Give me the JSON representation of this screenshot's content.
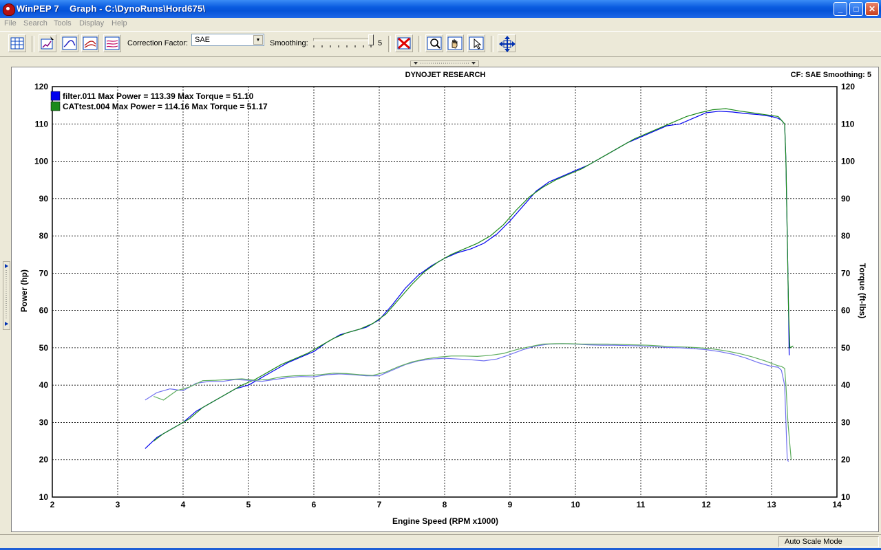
{
  "window": {
    "title": "WinPEP 7    Graph - C:\\DynoRuns\\Hord675\\",
    "minimize": "_",
    "maximize": "□",
    "close": "✕"
  },
  "menu": {
    "file": "File",
    "search": "Search",
    "tools": "Tools",
    "display": "Display",
    "help": "Help"
  },
  "toolbar": {
    "correction_label": "Correction Factor:",
    "correction_value": "SAE",
    "smoothing_label": "Smoothing:",
    "smoothing_value": "5",
    "smoothing_level": 5
  },
  "chart_header": {
    "title": "DYNOJET RESEARCH",
    "info": "CF: SAE  Smoothing: 5"
  },
  "status": {
    "mode": "Auto Scale Mode"
  },
  "colors": {
    "run1": "#0000ee",
    "run2": "#1a8a1a",
    "grid": "#000000"
  },
  "chart_data": {
    "type": "line",
    "xlabel": "Engine Speed (RPM x1000)",
    "ylabel": "Power (hp)",
    "ylabel_right": "Torque (ft-lbs)",
    "xlim": [
      2,
      14
    ],
    "ylim": [
      10,
      120
    ],
    "ylim_right": [
      10,
      120
    ],
    "x_ticks": [
      "2",
      "3",
      "4",
      "5",
      "6",
      "7",
      "8",
      "9",
      "10",
      "11",
      "12",
      "13",
      "14"
    ],
    "y_ticks": [
      "10",
      "20",
      "30",
      "40",
      "50",
      "60",
      "70",
      "80",
      "90",
      "100",
      "110",
      "120"
    ],
    "grid": true,
    "legend_position": "top-left",
    "legend": [
      {
        "label": "filter.011 Max Power = 113.39 Max Torque = 51.10",
        "color": "#0000ee"
      },
      {
        "label": "CATtest.004 Max Power = 114.16 Max Torque = 51.17",
        "color": "#1a8a1a"
      }
    ],
    "series": [
      {
        "name": "filter.011",
        "kind": "power",
        "axis": "left",
        "color": "#0000ee",
        "x": [
          3.42,
          3.6,
          3.8,
          4.0,
          4.2,
          4.4,
          4.6,
          4.8,
          5.0,
          5.2,
          5.4,
          5.6,
          5.8,
          6.0,
          6.2,
          6.4,
          6.6,
          6.8,
          7.0,
          7.2,
          7.4,
          7.6,
          7.8,
          8.0,
          8.2,
          8.4,
          8.6,
          8.8,
          9.0,
          9.2,
          9.4,
          9.6,
          9.8,
          10.0,
          10.2,
          10.4,
          10.6,
          10.8,
          11.0,
          11.2,
          11.4,
          11.6,
          11.8,
          12.0,
          12.2,
          12.4,
          12.6,
          12.8,
          13.0,
          13.1,
          13.15,
          13.2,
          13.22,
          13.24,
          13.26,
          13.27
        ],
        "y": [
          23,
          26,
          28,
          30,
          33,
          35,
          37,
          39,
          40,
          42,
          44,
          46,
          47.5,
          49,
          51.5,
          53.5,
          54.5,
          55.5,
          57.5,
          61.5,
          66,
          69.5,
          72,
          74,
          75.5,
          76.5,
          78,
          80.5,
          84,
          88,
          92,
          94.5,
          96,
          97.5,
          99,
          101,
          103,
          105,
          106.5,
          108,
          109.5,
          110,
          111.5,
          113,
          113.4,
          113.2,
          112.8,
          112.5,
          112,
          111.5,
          111,
          110,
          100,
          80,
          60,
          48
        ]
      },
      {
        "name": "CATtest.004",
        "kind": "power",
        "axis": "left",
        "color": "#1a8a1a",
        "x": [
          3.55,
          3.7,
          3.9,
          4.1,
          4.3,
          4.5,
          4.7,
          4.9,
          5.1,
          5.3,
          5.5,
          5.7,
          5.9,
          6.1,
          6.3,
          6.5,
          6.7,
          6.9,
          7.1,
          7.3,
          7.5,
          7.7,
          7.9,
          8.1,
          8.3,
          8.5,
          8.7,
          8.9,
          9.1,
          9.3,
          9.5,
          9.7,
          9.9,
          10.1,
          10.3,
          10.5,
          10.7,
          10.9,
          11.1,
          11.3,
          11.5,
          11.7,
          11.9,
          12.1,
          12.3,
          12.5,
          12.7,
          12.9,
          13.1,
          13.15,
          13.2,
          13.22,
          13.24,
          13.26,
          13.28,
          13.33
        ],
        "y": [
          25,
          27,
          29,
          31,
          34,
          36,
          38,
          40,
          41.5,
          43.5,
          45.5,
          47,
          48.5,
          50.5,
          52.5,
          54,
          55,
          56.5,
          59,
          63,
          67,
          70.5,
          73,
          75,
          76.5,
          78,
          80,
          83,
          87,
          90.5,
          93,
          95,
          96.5,
          98,
          100,
          102,
          104,
          106,
          107.5,
          109,
          110.5,
          112,
          113,
          113.8,
          114.1,
          113.5,
          113,
          112.5,
          112,
          111,
          110,
          100,
          80,
          60,
          50,
          50.5
        ]
      },
      {
        "name": "filter.011",
        "kind": "torque",
        "axis": "right",
        "color": "#7070f0",
        "x": [
          3.42,
          3.6,
          3.8,
          4.0,
          4.2,
          4.4,
          4.6,
          4.8,
          5.0,
          5.2,
          5.4,
          5.6,
          5.8,
          6.0,
          6.2,
          6.4,
          6.6,
          6.8,
          7.0,
          7.2,
          7.4,
          7.6,
          7.8,
          8.0,
          8.2,
          8.4,
          8.6,
          8.8,
          9.0,
          9.2,
          9.4,
          9.6,
          9.8,
          10.0,
          10.2,
          10.4,
          10.6,
          10.8,
          11.0,
          11.2,
          11.4,
          11.6,
          11.8,
          12.0,
          12.2,
          12.4,
          12.6,
          12.8,
          13.0,
          13.1,
          13.15,
          13.2,
          13.22,
          13.24,
          13.26
        ],
        "y": [
          36,
          38,
          39,
          38.5,
          40.5,
          41,
          41,
          41.5,
          41.3,
          41,
          41.5,
          42,
          42.3,
          42.2,
          42.8,
          43,
          42.8,
          42.5,
          42.5,
          44,
          45.5,
          46.5,
          47,
          47.2,
          47,
          46.8,
          46.5,
          47,
          48.2,
          49.5,
          50.5,
          51,
          51.1,
          51,
          50.8,
          50.7,
          50.7,
          50.6,
          50.5,
          50.3,
          50.1,
          50,
          49.8,
          49.5,
          49,
          48.3,
          47.3,
          46,
          45,
          44.8,
          44,
          40,
          30,
          20,
          19.5
        ]
      },
      {
        "name": "CATtest.004",
        "kind": "torque",
        "axis": "right",
        "color": "#5fae5f",
        "x": [
          3.55,
          3.7,
          3.9,
          4.1,
          4.3,
          4.5,
          4.7,
          4.9,
          5.1,
          5.3,
          5.5,
          5.7,
          5.9,
          6.1,
          6.3,
          6.5,
          6.7,
          6.9,
          7.1,
          7.3,
          7.5,
          7.7,
          7.9,
          8.1,
          8.3,
          8.5,
          8.7,
          8.9,
          9.1,
          9.3,
          9.5,
          9.7,
          9.9,
          10.1,
          10.3,
          10.5,
          10.7,
          10.9,
          11.1,
          11.3,
          11.5,
          11.7,
          11.9,
          12.1,
          12.3,
          12.5,
          12.7,
          12.9,
          13.1,
          13.15,
          13.2,
          13.22,
          13.25,
          13.3
        ],
        "y": [
          37,
          36,
          38.5,
          39.5,
          41.2,
          41.3,
          41.5,
          41.7,
          41.3,
          41.5,
          42.2,
          42.5,
          42.6,
          42.8,
          43.2,
          43.1,
          42.8,
          42.6,
          43.5,
          45,
          46.2,
          47,
          47.5,
          47.8,
          47.8,
          47.7,
          48,
          48.5,
          49.5,
          50.3,
          51,
          51.1,
          51.1,
          51,
          51,
          51,
          50.9,
          50.8,
          50.7,
          50.5,
          50.3,
          50.2,
          50,
          49.7,
          49.2,
          48.5,
          47.6,
          46.5,
          45.2,
          45,
          44.5,
          40,
          30,
          20
        ]
      }
    ]
  }
}
